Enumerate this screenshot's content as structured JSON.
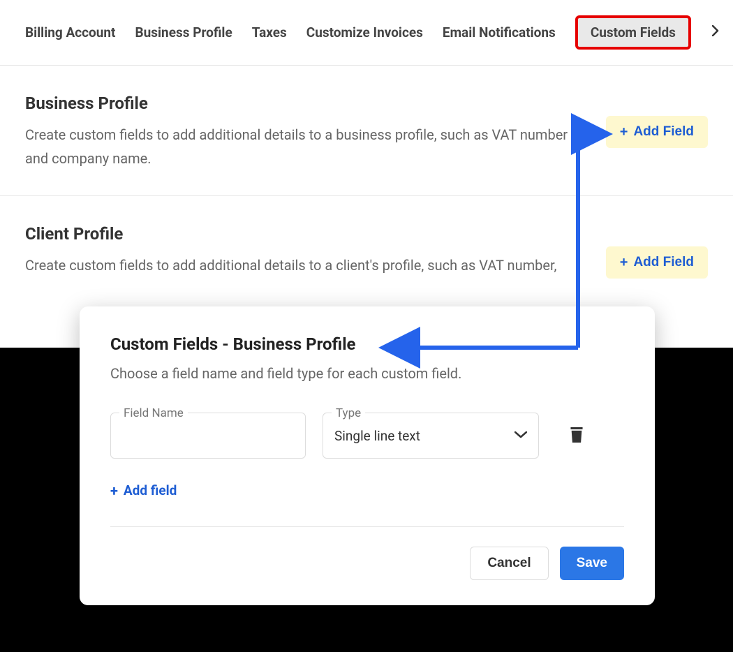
{
  "tabs": [
    "Billing Account",
    "Business Profile",
    "Taxes",
    "Customize Invoices",
    "Email Notifications",
    "Custom Fields"
  ],
  "sections": {
    "business": {
      "title": "Business Profile",
      "desc": "Create custom fields to add additional details to a business profile, such as VAT number and company name.",
      "addLabel": "Add Field"
    },
    "client": {
      "title": "Client Profile",
      "desc": "Create custom fields to add additional details to a client's profile, such as VAT number,",
      "addLabel": "Add Field"
    }
  },
  "dialog": {
    "title": "Custom Fields - Business Profile",
    "desc": "Choose a field name and field type for each custom field.",
    "fieldNameLabel": "Field Name",
    "typeLabel": "Type",
    "typeValue": "Single line text",
    "addFieldLabel": "Add field",
    "cancelLabel": "Cancel",
    "saveLabel": "Save"
  },
  "icons": {
    "plus": "+"
  }
}
